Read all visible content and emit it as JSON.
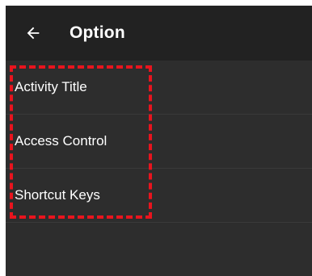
{
  "app_bar": {
    "title": "Option",
    "back_icon": "arrow-left-icon"
  },
  "menu": {
    "items": [
      {
        "label": "Activity Title"
      },
      {
        "label": "Access Control"
      },
      {
        "label": "Shortcut Keys"
      }
    ]
  },
  "colors": {
    "app_bar_background": "#222222",
    "list_background": "#2d2d2d",
    "text": "#ffffff",
    "highlight_border": "#e8141e"
  }
}
